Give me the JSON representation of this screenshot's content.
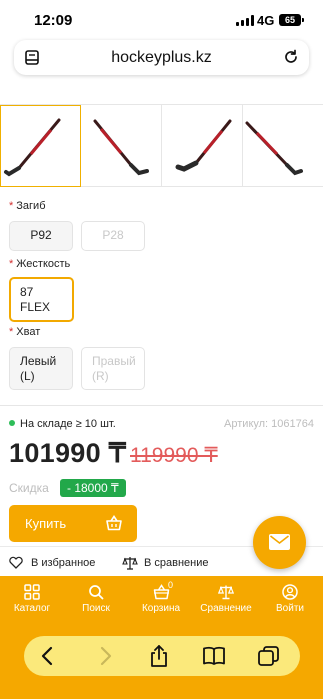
{
  "status_bar": {
    "time": "12:09",
    "network": "4G",
    "battery": "65"
  },
  "browser": {
    "url": "hockeyplus.kz"
  },
  "options": {
    "curve": {
      "label": "Загиб",
      "values": [
        "P92",
        "P28"
      ]
    },
    "flex": {
      "label": "Жесткость",
      "values": [
        "87\nFLEX"
      ]
    },
    "grip": {
      "label": "Хват",
      "values": [
        "Левый\n(L)",
        "Правый\n(R)"
      ]
    }
  },
  "product": {
    "stock": "На складе ≥ 10 шт.",
    "sku": "Артикул: 1061764",
    "price": "101990 ₸",
    "old_price": "119990 ₸",
    "discount_label": "Скидка",
    "discount_value": "- 18000 ₸",
    "buy_label": "Купить",
    "favorites_label": "В избранное",
    "compare_label": "В сравнение"
  },
  "colors": {
    "accent": "#f5a800",
    "old_price": "#e35b5b",
    "discount": "#22a84a",
    "in_stock": "#2ebd59"
  },
  "bottom_nav": {
    "items": [
      {
        "label": "Каталог",
        "icon": "grid-icon"
      },
      {
        "label": "Поиск",
        "icon": "search-icon"
      },
      {
        "label": "Корзина",
        "icon": "basket-icon",
        "badge": "0"
      },
      {
        "label": "Сравнение",
        "icon": "scales-icon"
      },
      {
        "label": "Войти",
        "icon": "user-icon"
      }
    ]
  },
  "safari_toolbar": [
    "back-icon",
    "forward-icon",
    "share-icon",
    "bookmarks-icon",
    "tabs-icon"
  ]
}
